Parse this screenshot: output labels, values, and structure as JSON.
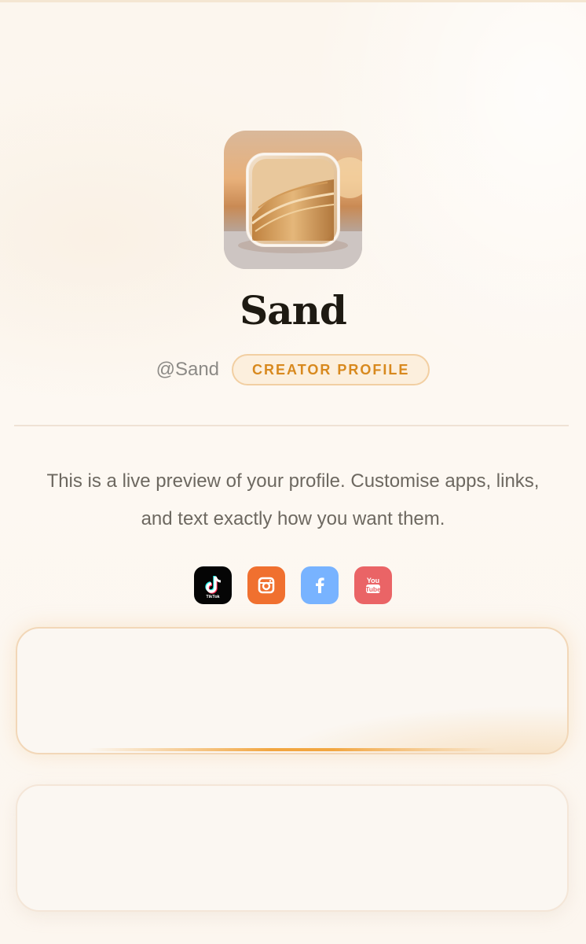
{
  "profile": {
    "name": "Sand",
    "handle": "@Sand",
    "badge": "CREATOR PROFILE",
    "bio": "This is a live preview of your profile. Customise apps, links, and text exactly how you want them."
  },
  "socials": [
    {
      "name": "tiktok-icon",
      "label": "TikTok",
      "color": "#050505"
    },
    {
      "name": "instagram-icon",
      "color": "#f0702f"
    },
    {
      "name": "facebook-icon",
      "color": "#78b3ff"
    },
    {
      "name": "youtube-icon",
      "label": "You Tube",
      "color": "#ea6466"
    }
  ],
  "colors": {
    "background": "#fdf8f1",
    "accent": "#d8891e",
    "badge_background": "#fcefdd",
    "title": "#1e1a12"
  },
  "links": [
    {
      "label": ""
    },
    {
      "label": ""
    }
  ]
}
